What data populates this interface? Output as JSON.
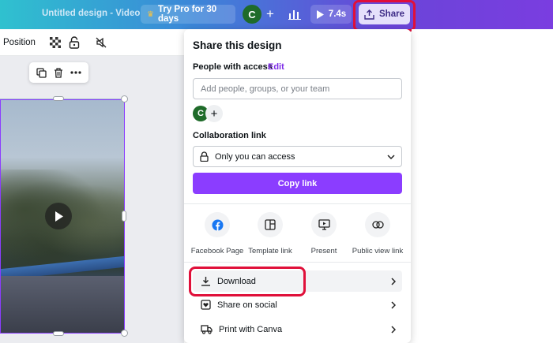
{
  "topbar": {
    "title": "Untitled design - Video",
    "try_pro": "Try Pro for 30 days",
    "avatar_initial": "C",
    "play_time": "7.4s",
    "share_label": "Share"
  },
  "toolbar": {
    "position_label": "Position"
  },
  "share_panel": {
    "title": "Share this design",
    "people_label": "People with access",
    "edit_label": "Edit",
    "add_placeholder": "Add people, groups, or your team",
    "avatar_initial": "C",
    "collab_label": "Collaboration link",
    "access_value": "Only you can access",
    "copy_link": "Copy link",
    "options": [
      {
        "label": "Facebook Page",
        "icon": "facebook-icon"
      },
      {
        "label": "Template link",
        "icon": "template-icon"
      },
      {
        "label": "Present",
        "icon": "present-icon"
      },
      {
        "label": "Public view link",
        "icon": "link-icon"
      }
    ],
    "rows": [
      {
        "label": "Download",
        "icon": "download-icon"
      },
      {
        "label": "Share on social",
        "icon": "heart-icon"
      },
      {
        "label": "Print with Canva",
        "icon": "truck-icon"
      }
    ]
  },
  "colors": {
    "accent": "#8b3dff",
    "highlight": "#e0103a"
  }
}
